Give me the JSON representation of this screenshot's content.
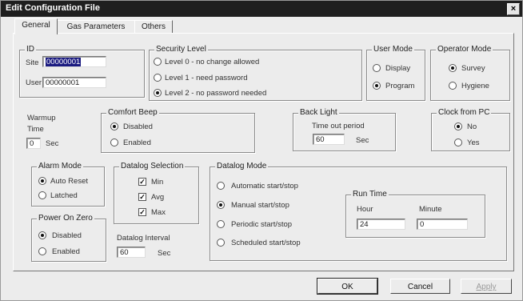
{
  "window": {
    "title": "Edit Configuration File",
    "close_glyph": "×"
  },
  "tabs": [
    {
      "label": "General",
      "active": true
    },
    {
      "label": "Gas Parameters"
    },
    {
      "label": "Others"
    }
  ],
  "id_group": {
    "legend": "ID",
    "site_label": "Site",
    "site_value": "00000001",
    "user_label": "User",
    "user_value": "00000001"
  },
  "security": {
    "legend": "Security Level",
    "options": [
      {
        "label": "Level 0 - no change allowed",
        "selected": false
      },
      {
        "label": "Level 1 - need password",
        "selected": false
      },
      {
        "label": "Level 2 - no password needed",
        "selected": true
      }
    ]
  },
  "user_mode": {
    "legend": "User Mode",
    "options": [
      {
        "label": "Display",
        "selected": false
      },
      {
        "label": "Program",
        "selected": true
      }
    ]
  },
  "operator_mode": {
    "legend": "Operator Mode",
    "options": [
      {
        "label": "Survey",
        "selected": true
      },
      {
        "label": "Hygiene",
        "selected": false
      }
    ]
  },
  "warmup": {
    "label_line1": "Warmup",
    "label_line2": "Time",
    "value": "0",
    "unit": "Sec"
  },
  "comfort_beep": {
    "legend": "Comfort Beep",
    "options": [
      {
        "label": "Disabled",
        "selected": true
      },
      {
        "label": "Enabled",
        "selected": false
      }
    ]
  },
  "back_light": {
    "legend": "Back Light",
    "caption": "Time out period",
    "value": "60",
    "unit": "Sec"
  },
  "clock_from_pc": {
    "legend": "Clock from PC",
    "options": [
      {
        "label": "No",
        "selected": true
      },
      {
        "label": "Yes",
        "selected": false
      }
    ]
  },
  "alarm_mode": {
    "legend": "Alarm Mode",
    "options": [
      {
        "label": "Auto Reset",
        "selected": true
      },
      {
        "label": "Latched",
        "selected": false
      }
    ]
  },
  "datalog_selection": {
    "legend": "Datalog Selection",
    "items": [
      {
        "label": "Min",
        "checked": true
      },
      {
        "label": "Avg",
        "checked": true
      },
      {
        "label": "Max",
        "checked": true
      }
    ],
    "check_glyph": "✓"
  },
  "datalog_interval": {
    "label": "Datalog Interval",
    "value": "60",
    "unit": "Sec"
  },
  "power_on_zero": {
    "legend": "Power On Zero",
    "options": [
      {
        "label": "Disabled",
        "selected": true
      },
      {
        "label": "Enabled",
        "selected": false
      }
    ]
  },
  "datalog_mode": {
    "legend": "Datalog Mode",
    "options": [
      {
        "label": "Automatic start/stop",
        "selected": false
      },
      {
        "label": "Manual start/stop",
        "selected": true
      },
      {
        "label": "Periodic start/stop",
        "selected": false
      },
      {
        "label": "Scheduled start/stop",
        "selected": false
      }
    ]
  },
  "run_time": {
    "legend": "Run Time",
    "hour_label": "Hour",
    "minute_label": "Minute",
    "hour_value": "24",
    "minute_value": "0"
  },
  "buttons": {
    "ok": "OK",
    "cancel": "Cancel",
    "apply": "Apply"
  }
}
